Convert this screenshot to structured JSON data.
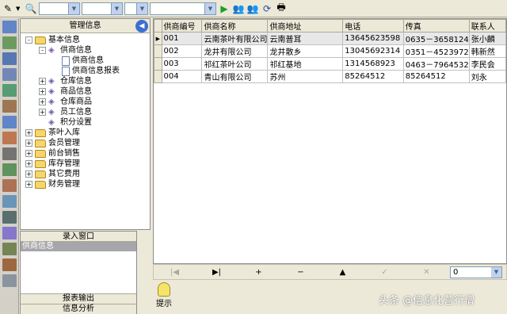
{
  "toolbar": {
    "icons": [
      "edit-icon",
      "search-icon",
      "go-icon",
      "find-icon",
      "find-next-icon",
      "refresh-icon",
      "print-icon"
    ],
    "combo1": "",
    "combo2": "",
    "combo3": "",
    "combo4": ""
  },
  "sidebar_icons": [
    "list-icon",
    "edit-icon",
    "table-icon",
    "doc-icon",
    "chart-icon",
    "mail-icon",
    "export-icon",
    "calendar-icon",
    "tools-icon",
    "users-icon",
    "link-icon",
    "inventory-icon",
    "report-icon",
    "settings-icon",
    "grid-icon",
    "people-icon",
    "trash-icon"
  ],
  "tree_panel": {
    "title": "管理信息",
    "nodes": [
      {
        "label": "基本信息",
        "level": 0,
        "exp": "-",
        "icon": "folder"
      },
      {
        "label": "供商信息",
        "level": 1,
        "exp": "-",
        "icon": "node"
      },
      {
        "label": "供商信息",
        "level": 2,
        "exp": "",
        "icon": "doc"
      },
      {
        "label": "供商信息报表",
        "level": 2,
        "exp": "",
        "icon": "doc"
      },
      {
        "label": "仓库信息",
        "level": 1,
        "exp": "+",
        "icon": "node"
      },
      {
        "label": "商品信息",
        "level": 1,
        "exp": "+",
        "icon": "node"
      },
      {
        "label": "仓库商品",
        "level": 1,
        "exp": "+",
        "icon": "node"
      },
      {
        "label": "员工信息",
        "level": 1,
        "exp": "+",
        "icon": "node"
      },
      {
        "label": "积分设置",
        "level": 1,
        "exp": "",
        "icon": "node"
      },
      {
        "label": "茶叶入库",
        "level": 0,
        "exp": "+",
        "icon": "folder"
      },
      {
        "label": "会员管理",
        "level": 0,
        "exp": "+",
        "icon": "folder"
      },
      {
        "label": "前台销售",
        "level": 0,
        "exp": "+",
        "icon": "folder"
      },
      {
        "label": "库存管理",
        "level": 0,
        "exp": "+",
        "icon": "folder"
      },
      {
        "label": "其它费用",
        "level": 0,
        "exp": "+",
        "icon": "folder"
      },
      {
        "label": "财务管理",
        "level": 0,
        "exp": "+",
        "icon": "folder"
      }
    ]
  },
  "entry_panel": {
    "title": "录入窗口",
    "selected": "供商信息",
    "tab1": "报表输出",
    "tab2": "信息分析"
  },
  "grid": {
    "columns": [
      "供商编号",
      "供商名称",
      "供商地址",
      "电话",
      "传真",
      "联系人"
    ],
    "rows": [
      [
        "001",
        "云南茶叶有限公司",
        "云南普耳",
        "13645623598",
        "0635－3658124",
        "张小麟"
      ],
      [
        "002",
        "龙井有限公司",
        "龙井散乡",
        "13045692314",
        "0351－4523972",
        "韩新然"
      ],
      [
        "003",
        "祁红茶叶公司",
        "祁红基地",
        "1314568923",
        "0463－7964532",
        "李民会"
      ],
      [
        "004",
        "青山有限公司",
        "苏州",
        "85264512",
        "85264512",
        "刘永"
      ]
    ],
    "selected_row": 0
  },
  "navbar": {
    "buttons": [
      "|◀",
      "▶|",
      "+",
      "−",
      "▲",
      "✓",
      "✕"
    ],
    "disabled": [
      true,
      false,
      false,
      false,
      false,
      true,
      true
    ],
    "select_value": "0"
  },
  "hint_label": "提示",
  "watermark": "头条 @信息化营行僧"
}
